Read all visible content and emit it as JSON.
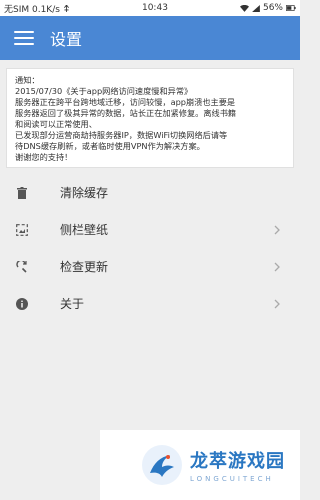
{
  "status": {
    "carrier": "无SIM 0.1K/s",
    "time": "10:43",
    "battery": "56%"
  },
  "appbar": {
    "title": "设置",
    "menu_icon": "hamburger-icon"
  },
  "notice": {
    "lines": [
      "通知：",
      "2015/07/30《关于app网络访问速度慢和异常》",
      "服务器正在跨平台跨地域迁移，访问较慢，app崩溃也主要是",
      "服务器返回了极其异常的数据，站长正在加紧修复。离线书籍",
      "和阅读可以正常使用、",
      "已发现部分运营商劫持服务器IP，数据WiFi切换网络后请等",
      "待DNS缓存刷新，或者临时使用VPN作为解决方案。",
      "谢谢您的支持！"
    ]
  },
  "menu": [
    {
      "label": "清除缓存",
      "icon": "trash-icon",
      "chevron": false
    },
    {
      "label": "侧栏壁纸",
      "icon": "wallpaper-icon",
      "chevron": true
    },
    {
      "label": "检查更新",
      "icon": "refresh-search-icon",
      "chevron": true
    },
    {
      "label": "关于",
      "icon": "info-icon",
      "chevron": true
    }
  ],
  "watermark": {
    "cn": "龙萃游戏园",
    "en": "LONGCUITECH"
  },
  "colors": {
    "primary": "#4a87d4",
    "background": "#eeeeee"
  }
}
